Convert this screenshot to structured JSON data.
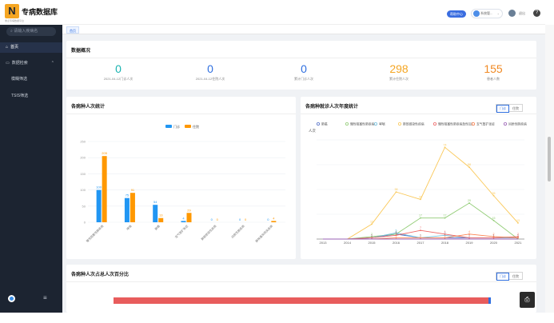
{
  "brand": {
    "logo_letter": "N",
    "title": "专病数据库",
    "subtitle": "重点专病数据平台"
  },
  "sidebar": {
    "search_placeholder": "请输入疾病名",
    "items": [
      {
        "label": "首页",
        "icon": "home-icon",
        "active": true
      },
      {
        "label": "数据检索",
        "icon": "folder-icon",
        "expanded": true
      },
      {
        "label": "模糊筛选"
      },
      {
        "label": "TSIS筛选"
      }
    ],
    "chevron": "⌃",
    "menu_glyph": "≡"
  },
  "topbar": {
    "help_pill": "帮助中心",
    "user_select_value": "系统管...",
    "dropdown_glyph": "⌄",
    "user_name": "退出",
    "help_glyph": "?"
  },
  "tabs": [
    {
      "label": "首页",
      "active": true
    }
  ],
  "overview": {
    "title": "数据概况",
    "stats": [
      {
        "value": "0",
        "label": "2021-04-12门诊人次",
        "color": "#19b3b0"
      },
      {
        "value": "0",
        "label": "2021-04-12住院人次",
        "color": "#2f6fe0"
      },
      {
        "value": "0",
        "label": "累计门诊人次",
        "color": "#2f6fe0"
      },
      {
        "value": "298",
        "label": "累计住院人次",
        "color": "#f5a623"
      },
      {
        "value": "155",
        "label": "患者人数",
        "color": "#f08a24"
      }
    ]
  },
  "bar_card": {
    "title": "各病种人次统计"
  },
  "trend_card": {
    "title": "各病种就诊人次年度统计",
    "toggle": [
      "门诊",
      "住院"
    ],
    "active_toggle": 0
  },
  "bottom_card": {
    "title": "各病种人次占总人次百分比",
    "toggle": [
      "门诊",
      "住院"
    ],
    "active_toggle": 0
  },
  "float_button_glyph": "⎙",
  "chart_data": [
    {
      "type": "bar",
      "title": "各病种人次统计",
      "categories": [
        "慢性阻塞性肺疾病",
        "哮喘",
        "肺癌",
        "支气管扩张症",
        "肺部感染性疾病",
        "间质性肺疾病",
        "肺栓塞及相关疾病"
      ],
      "series": [
        {
          "name": "门诊",
          "color": "#2196f3",
          "values": [
            100,
            75,
            54,
            4,
            0,
            0,
            0
          ]
        },
        {
          "name": "住院",
          "color": "#ff9800",
          "values": [
            205,
            91,
            13,
            29,
            0,
            0,
            4
          ]
        }
      ],
      "ylim": [
        0,
        250
      ],
      "yticks": [
        0,
        50,
        100,
        150,
        200,
        250
      ],
      "grid": true,
      "legend": "top-center"
    },
    {
      "type": "line",
      "title": "各病种就诊人次年度统计",
      "ylabel": "人次",
      "x": [
        "2013",
        "2014",
        "2015",
        "2016",
        "2017",
        "2018",
        "2019",
        "2020",
        "2021"
      ],
      "series": [
        {
          "name": "肺癌",
          "color": "#5470c6",
          "values": [
            0,
            0,
            1,
            4,
            1,
            1,
            1,
            1,
            1
          ]
        },
        {
          "name": "慢性阻塞性肺疾病",
          "color": "#91cc75",
          "values": [
            0,
            0,
            2,
            4,
            17,
            17,
            29,
            15,
            0
          ]
        },
        {
          "name": "哮喘",
          "color": "#73c0de",
          "values": [
            0,
            0,
            1,
            5,
            1,
            3,
            1,
            1,
            1
          ]
        },
        {
          "name": "肺部感染性疾病",
          "color": "#fac858",
          "values": [
            0,
            0,
            12,
            38,
            32,
            74,
            58,
            35,
            13
          ]
        },
        {
          "name": "慢性阻塞性肺疾病急性加重",
          "color": "#ee6666",
          "values": [
            0,
            0,
            1,
            3,
            7,
            4,
            1,
            1,
            2
          ]
        },
        {
          "name": "支气管扩张症",
          "color": "#fc8452",
          "values": [
            0,
            0,
            0,
            1,
            1,
            1,
            4,
            2,
            1
          ]
        },
        {
          "name": "间质性肺疾病",
          "color": "#9a60b4",
          "values": [
            0,
            0,
            0,
            0,
            0,
            0,
            0,
            0,
            0
          ]
        }
      ],
      "legend": "top",
      "grid": true
    }
  ]
}
